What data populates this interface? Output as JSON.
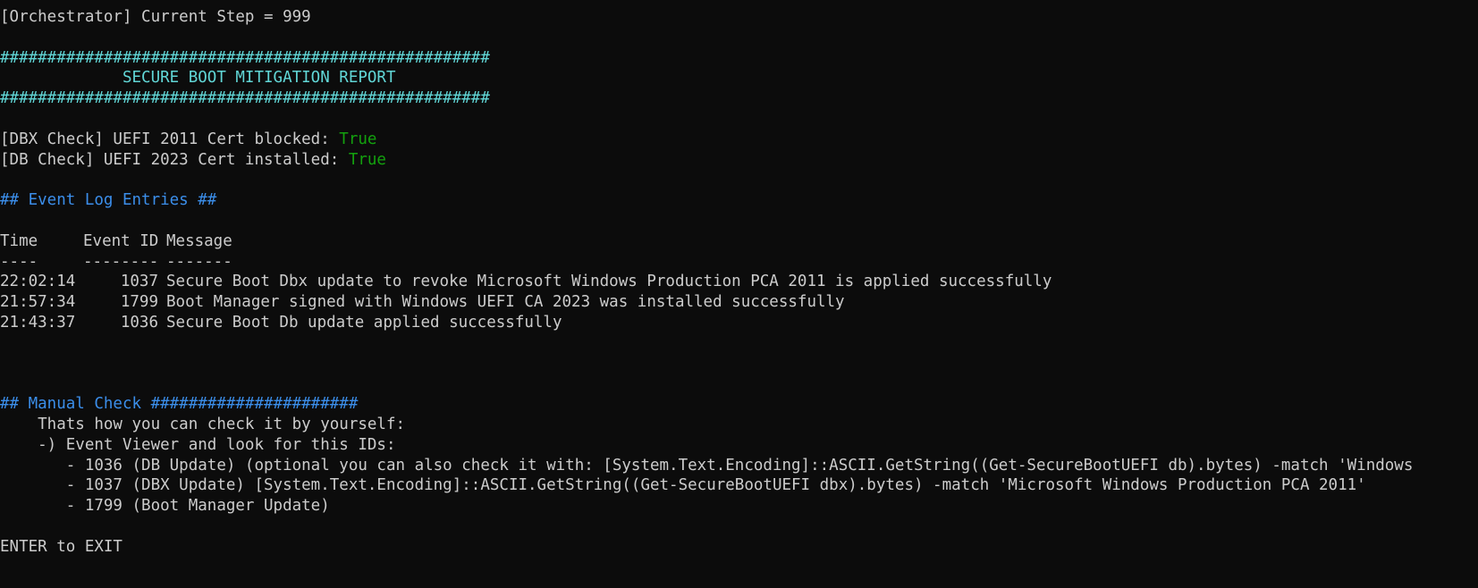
{
  "window": {
    "header_line": "[Orchestrator] Current Step = 999"
  },
  "report": {
    "hash_bar": "####################################################",
    "title": "             SECURE BOOT MITIGATION REPORT"
  },
  "checks": [
    {
      "label": "[DBX Check] UEFI 2011 Cert blocked: ",
      "value": "True"
    },
    {
      "label": "[DB Check] UEFI 2023 Cert installed: ",
      "value": "True"
    }
  ],
  "event_log": {
    "heading": "## Event Log Entries ##",
    "columns": [
      "Time",
      "Event ID",
      "Message"
    ],
    "separators": [
      "----",
      "--------",
      "-------"
    ],
    "rows": [
      {
        "time": "22:02:14",
        "id": "1037",
        "message": "Secure Boot Dbx update to revoke Microsoft Windows Production PCA 2011 is applied successfully"
      },
      {
        "time": "21:57:34",
        "id": "1799",
        "message": "Boot Manager signed with Windows UEFI CA 2023 was installed successfully"
      },
      {
        "time": "21:43:37",
        "id": "1036",
        "message": "Secure Boot Db update applied successfully"
      }
    ]
  },
  "manual_check": {
    "heading": "## Manual Check ######################",
    "lines": [
      "    Thats how you can check it by yourself:",
      "    -) Event Viewer and look for this IDs:",
      "       - 1036 (DB Update) (optional you can also check it with: [System.Text.Encoding]::ASCII.GetString((Get-SecureBootUEFI db).bytes) -match 'Windows",
      "       - 1037 (DBX Update) [System.Text.Encoding]::ASCII.GetString((Get-SecureBootUEFI dbx).bytes) -match 'Microsoft Windows Production PCA 2011'",
      "       - 1799 (Boot Manager Update)"
    ]
  },
  "footer": {
    "prompt": "ENTER to EXIT"
  },
  "colors": {
    "background": "#0c0c0c",
    "text": "#cccccc",
    "cyan": "#61d6d6",
    "blue": "#3b8eea",
    "green": "#13a10e"
  }
}
